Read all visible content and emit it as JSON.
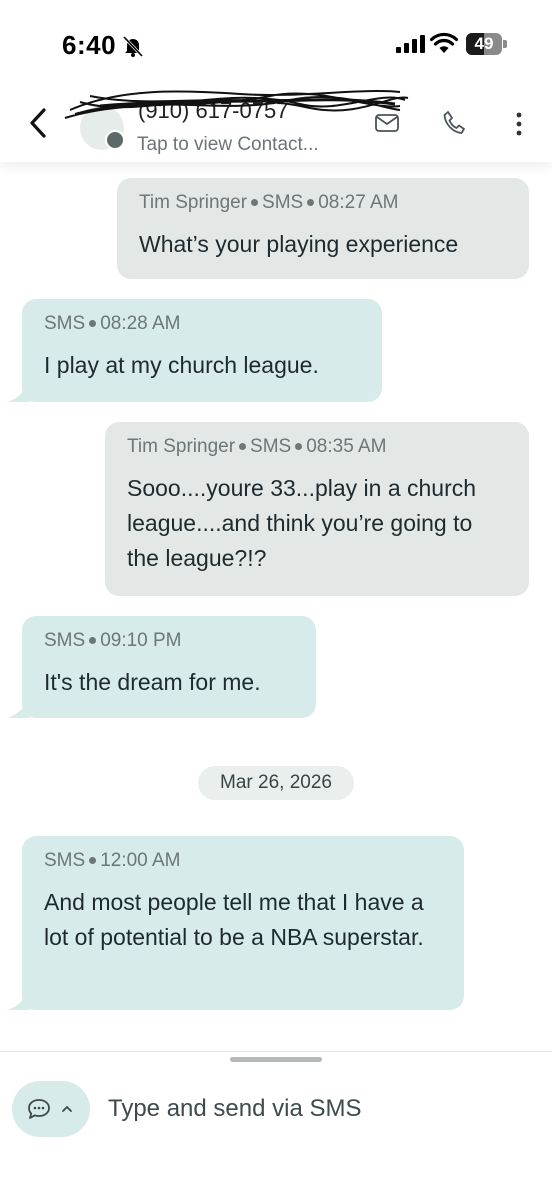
{
  "status_bar": {
    "time": "6:40",
    "battery": "49"
  },
  "header": {
    "contact_name": "(910) 617-0757",
    "subtitle": "Tap to view Contact..."
  },
  "messages": [
    {
      "direction": "out",
      "sender": "Tim  Springer",
      "channel": "SMS",
      "time": "08:27 AM",
      "text": "What’s your playing experience"
    },
    {
      "direction": "in",
      "sender": "",
      "channel": "SMS",
      "time": "08:28 AM",
      "text": "I play at my church league."
    },
    {
      "direction": "out",
      "sender": "Tim  Springer",
      "channel": "SMS",
      "time": "08:35 AM",
      "text": "Sooo....youre 33...play in a church league....and think you’re going to the league?!?"
    },
    {
      "direction": "in",
      "sender": "",
      "channel": "SMS",
      "time": "09:10 PM",
      "text": "It's the dream for me."
    },
    {
      "direction": "in",
      "sender": "",
      "channel": "SMS",
      "time": "12:00 AM",
      "text": "And most people tell me that I have a lot of potential to be a NBA superstar."
    }
  ],
  "date_separator": "Mar 26, 2026",
  "composer": {
    "placeholder": "Type and send via SMS"
  }
}
